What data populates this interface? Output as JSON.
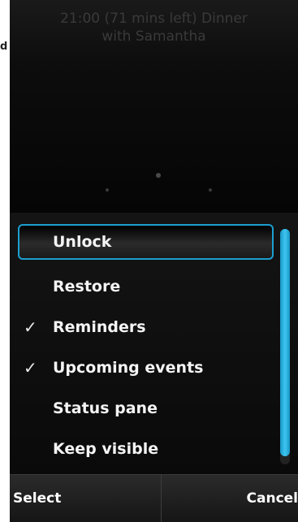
{
  "edge_label": "d",
  "lockscreen": {
    "reminder_line1": "21:00 (71 mins left) Dinner",
    "reminder_line2": "with Samantha"
  },
  "menu": {
    "items": [
      {
        "label": "Unlock",
        "checked": false,
        "selected": true
      },
      {
        "label": "Restore",
        "checked": false,
        "selected": false
      },
      {
        "label": "Reminders",
        "checked": true,
        "selected": false
      },
      {
        "label": "Upcoming events",
        "checked": true,
        "selected": false
      },
      {
        "label": "Status pane",
        "checked": false,
        "selected": false
      },
      {
        "label": "Keep visible",
        "checked": false,
        "selected": false
      }
    ],
    "check_glyph": "✓"
  },
  "softkeys": {
    "left": "Select",
    "right": "Cancel"
  },
  "colors": {
    "accent": "#1c9fd0",
    "background": "#050505",
    "text": "#f4f4f4"
  }
}
